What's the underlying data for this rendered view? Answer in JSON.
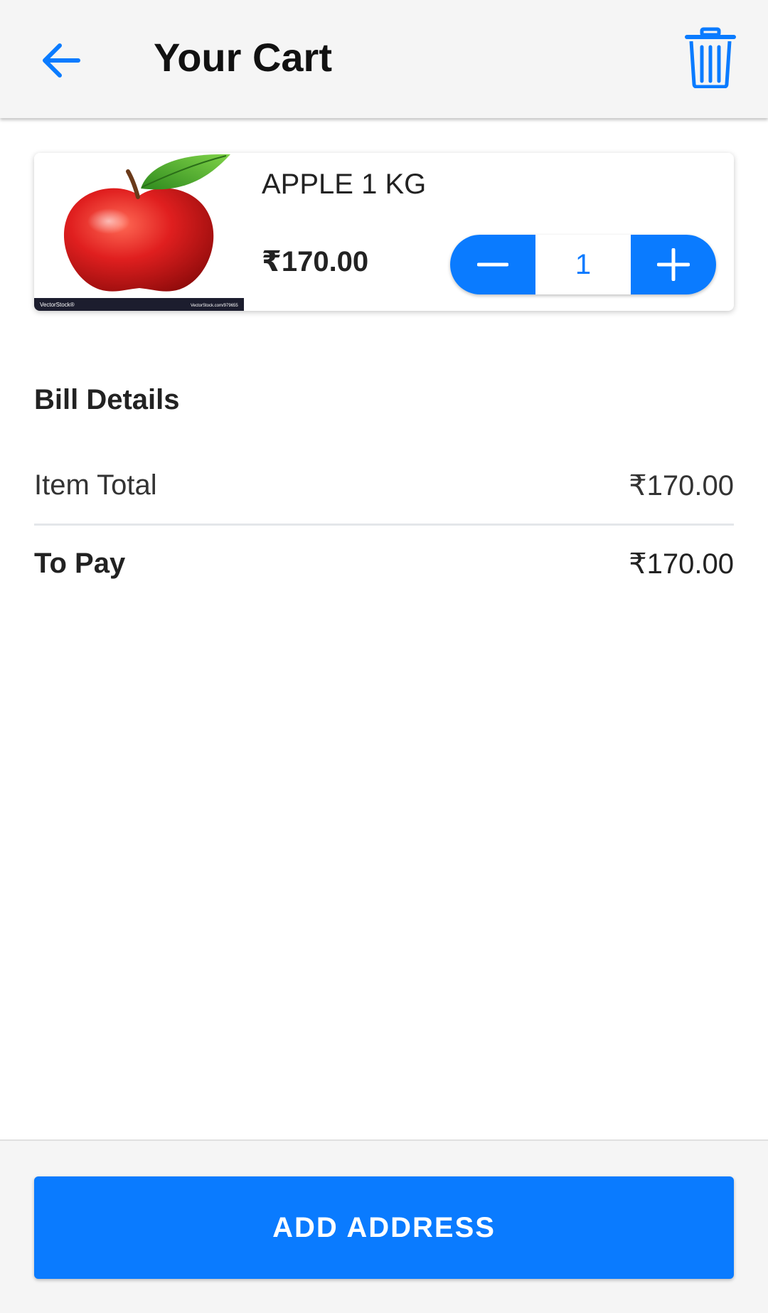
{
  "header": {
    "title": "Your Cart",
    "back_icon": "arrow-left-icon",
    "trash_icon": "trash-icon"
  },
  "cart_items": [
    {
      "name": "APPLE 1 KG",
      "price": "₹170.00",
      "quantity": "1",
      "image": "apple-image",
      "image_watermark_left": "VectorStock®",
      "image_watermark_right": "VectorStock.com/979655"
    }
  ],
  "bill": {
    "title": "Bill Details",
    "item_total_label": "Item Total",
    "item_total_value": "₹170.00",
    "to_pay_label": "To Pay",
    "to_pay_value": "₹170.00"
  },
  "footer": {
    "cta_label": "ADD ADDRESS"
  },
  "colors": {
    "accent": "#0a7bff",
    "appbar_bg": "#f5f5f5",
    "text": "#222222"
  }
}
